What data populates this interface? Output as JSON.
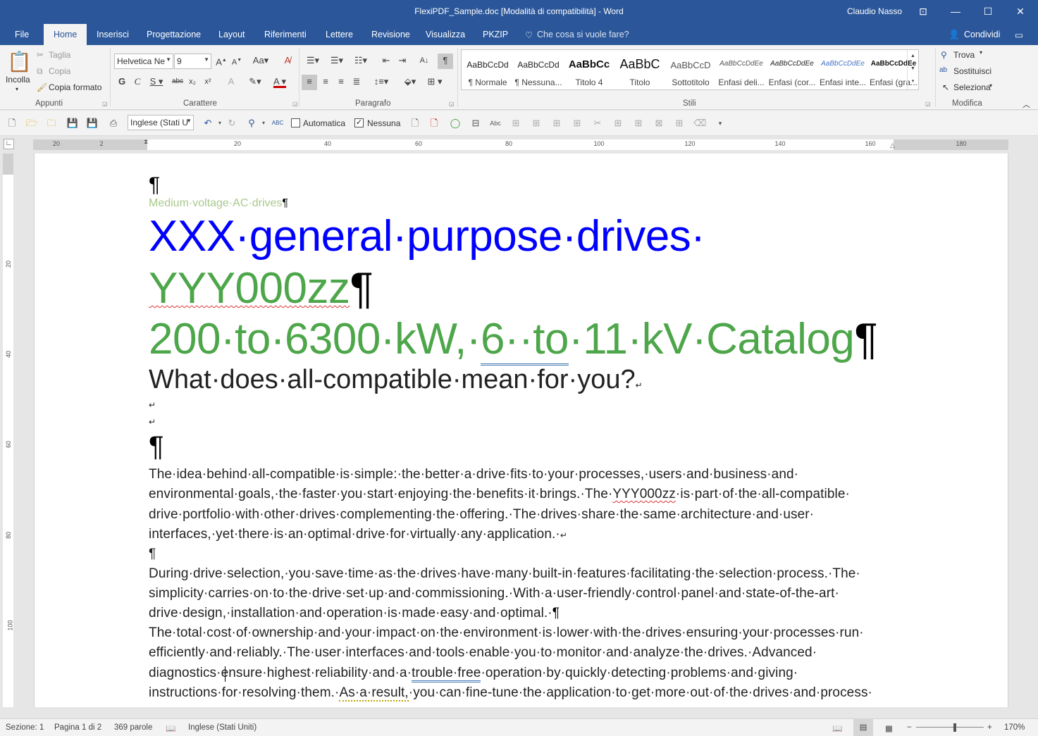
{
  "window": {
    "title": "FlexiPDF_Sample.doc [Modalità di compatibilità]  -  Word",
    "user": "Claudio Nasso"
  },
  "tabs": [
    "File",
    "Home",
    "Inserisci",
    "Progettazione",
    "Layout",
    "Riferimenti",
    "Lettere",
    "Revisione",
    "Visualizza",
    "PKZIP"
  ],
  "tell_me": "Che cosa si vuole fare?",
  "share": "Condividi",
  "clipboard": {
    "paste": "Incolla",
    "cut": "Taglia",
    "copy": "Copia",
    "format_painter": "Copia formato",
    "label": "Appunti"
  },
  "font": {
    "name": "Helvetica Ne",
    "size": "9",
    "label": "Carattere"
  },
  "paragraph": {
    "label": "Paragrafo"
  },
  "styles": {
    "label": "Stili",
    "items": [
      {
        "preview": "AaBbCcDd",
        "name": "¶ Normale"
      },
      {
        "preview": "AaBbCcDd",
        "name": "¶ Nessuna..."
      },
      {
        "preview": "AaBbCc",
        "name": "Titolo 4"
      },
      {
        "preview": "AaBbC",
        "name": "Titolo"
      },
      {
        "preview": "AaBbCcD",
        "name": "Sottotitolo"
      },
      {
        "preview": "AaBbCcDdEe",
        "name": "Enfasi deli..."
      },
      {
        "preview": "AaBbCcDdEe",
        "name": "Enfasi (cor..."
      },
      {
        "preview": "AaBbCcDdEe",
        "name": "Enfasi inte..."
      },
      {
        "preview": "AaBbCcDdEe",
        "name": "Enfasi (gra..."
      }
    ]
  },
  "editing": {
    "find": "Trova",
    "replace": "Sostituisci",
    "select": "Seleziona",
    "label": "Modifica"
  },
  "qat": {
    "language": "Inglese (Stati U",
    "auto": "Automatica",
    "none": "Nessuna"
  },
  "ruler": {
    "h_numbers": [
      "20",
      "2",
      "20",
      "40",
      "60",
      "80",
      "100",
      "120",
      "140",
      "160",
      "180"
    ],
    "v_numbers": [
      "20",
      "40",
      "60",
      "80",
      "100"
    ]
  },
  "document": {
    "pilcrow": "¶",
    "kicker": "Medium·voltage·AC·drives",
    "title_a": "XXX·general·purpose·drives·",
    "title_b": "YYY000zz",
    "title_c1": "200·to·6300·kW,·",
    "title_c2": "6··to",
    "title_c3": "·11·kV·Catalog",
    "subtitle": "What·does·all-compatible·mean·for·you?",
    "break": "↵",
    "p1": [
      "The·idea·behind·all-compatible·is·simple:·the·better·a·drive·fits·to·your·processes,·users·and·business·and·",
      "environmental·goals,·the·faster·you·start·enjoying·the·benefits·it·brings.·The·",
      "YYY000zz",
      "·is·part·of·the·all-compatible·",
      "drive·portfolio·with·other·drives·complementing·the·offering.·The·drives·share·the·same·architecture·and·user·",
      "interfaces,·yet·there·is·an·optimal·drive·for·virtually·any·application.·"
    ],
    "p2": [
      "During·drive·selection,·you·save·time·as·the·drives·have·many·built-in·features·facilitating·the·selection·process.·The·",
      "simplicity·carries·on·to·the·drive·set·up·and·commissioning.·With·a·user-friendly·control·panel·and·state-of-the-art·",
      "drive·design,·installation·and·operation·is·made·easy·and·optimal.·"
    ],
    "p3": [
      "The·total·cost·of·ownership·and·your·impact·on·the·environment·is·lower·with·the·drives·ensuring·your·processes·run·",
      "efficiently·and·reliably.·The·user·interfaces·and·tools·enable·you·to·monitor·and·analyze·the·drives.·Advanced·",
      "diagnostics·ensure·highest·reliability·and·a·",
      "trouble·free",
      "·operation·by·quickly·detecting·problems·and·giving·",
      "instructions·for·resolving·them.·",
      "As·a·result,",
      "·you·can·fine-tune·the·application·to·get·more·out·of·the·drives·and·process·"
    ]
  },
  "status": {
    "section": "Sezione: 1",
    "page": "Pagina 1 di 2",
    "words": "369 parole",
    "language": "Inglese (Stati Uniti)",
    "zoom": "170%"
  },
  "colors": {
    "accent": "#2b579a",
    "title_blue": "#0000ff",
    "title_green": "#4ea64a",
    "kicker_green": "#a9c98b"
  }
}
